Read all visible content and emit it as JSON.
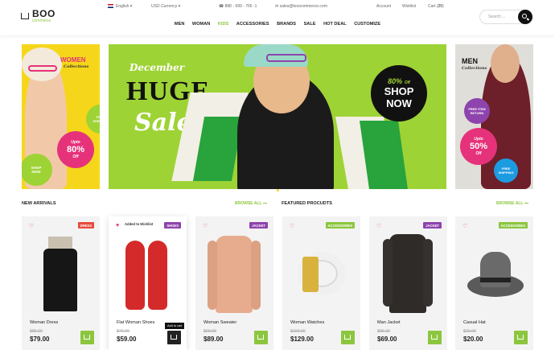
{
  "brand": {
    "name": "BOO",
    "tagline": "commerce"
  },
  "utility": {
    "language": "English",
    "currency": "USD Currency",
    "phone": "888 - 999 - 765 -1",
    "email": "sales@boocommerce.com",
    "account": "Account",
    "wishlist": "Wishlist",
    "cart_label": "Cart (",
    "cart_count": "20",
    "cart_close": ")"
  },
  "nav": [
    "MEN",
    "WOMAN",
    "KIDS",
    "ACCESSORIES",
    "BRANDS",
    "SALE",
    "HOT DEAL",
    "CUSTOMIZE"
  ],
  "search": {
    "placeholder": "Search ..."
  },
  "banners": {
    "women": {
      "title": "WOMEN",
      "sub": "Collections",
      "free": "FREE SHIPPING",
      "upto": "Upto",
      "pct": "80%",
      "off": "Off",
      "shop": "SHOP NOW"
    },
    "hero": {
      "month": "December",
      "huge": "HUGE",
      "sale": "Sale",
      "pct": "80%",
      "off": "Off",
      "shop": "SHOP",
      "now": "NOW"
    },
    "men": {
      "title": "MEN",
      "sub": "Collections",
      "free_return": "FREE ITEM RETURN",
      "upto": "Upto",
      "pct": "50%",
      "off": "Off",
      "free": "FREE SHIPPING"
    }
  },
  "sections": {
    "new": "NEW ARRIVALS",
    "featured": "FEATURED PROCUDTS",
    "browse": "BROWSE ALL"
  },
  "products": [
    {
      "name": "Woman Dress",
      "old": "$85.00",
      "price": "$79.00",
      "badge": "DRESS",
      "color": "#e74c3c"
    },
    {
      "name": "Flat Woman Shoes",
      "old": "$79.00",
      "price": "$59.00",
      "badge": "SHOES",
      "color": "#8e44ad",
      "wish": "Added to Wishlist",
      "tip": "Add to cart"
    },
    {
      "name": "Woman Sweater",
      "old": "$99.00",
      "price": "$89.00",
      "badge": "JACKET",
      "color": "#8e44ad"
    },
    {
      "name": "Woman Watches",
      "old": "$169.00",
      "price": "$129.00",
      "badge": "ACCESSORIES",
      "color": "#8cc63f"
    },
    {
      "name": "Man Jacket",
      "old": "$85.00",
      "price": "$69.00",
      "badge": "JACKET",
      "color": "#8e44ad"
    },
    {
      "name": "Casual Hat",
      "old": "$29.00",
      "price": "$20.00",
      "badge": "ACCESSORIES",
      "color": "#8cc63f"
    }
  ],
  "colors": {
    "accent": "#8cc63f",
    "hero_bg": "#9ed335",
    "women_bg": "#f6d61a",
    "pink": "#e6327a",
    "purple": "#8e44ad"
  }
}
